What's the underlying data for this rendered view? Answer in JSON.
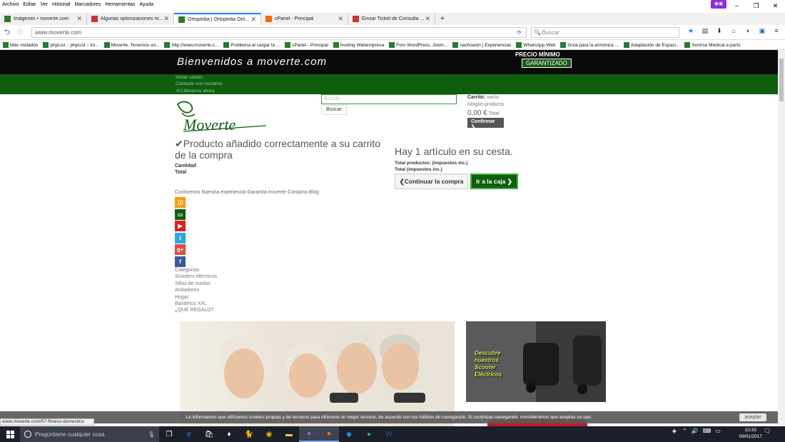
{
  "menubar": [
    "Archivo",
    "Editar",
    "Ver",
    "Historial",
    "Marcadores",
    "Herramientas",
    "Ayuda"
  ],
  "tabs": [
    {
      "title": "Imágenes • moverte.com",
      "fav": "#2a7a2a"
    },
    {
      "title": "Algunas optimizaciones re...",
      "fav": "#c33"
    },
    {
      "title": "Ortopedia | Ortopedia Onl...",
      "fav": "#2a7a2a"
    },
    {
      "title": "cPanel - Principal",
      "fav": "#f60"
    },
    {
      "title": "Enviar Ticket de Consulta ...",
      "fav": "#c33"
    }
  ],
  "url": "www.moverte.com",
  "search_placeholder": "Buscar",
  "bookmarks": [
    "Más visitados",
    "phpList :: phpList :: ini...",
    "Moverte. Tenemos un...",
    "http://www.moverte.c...",
    "Problema al cargar la ...",
    "cPanel - Principal",
    "hosting Webempresa",
    "Foro WordPress, Joom...",
    "nachoasin | Experiencias",
    "WhatsApp Web",
    "Guía para la armónica ...",
    "Adaptación de Espaci...",
    "Sunrise Medical e-parts"
  ],
  "site": {
    "welcome": "Bienvenidos a moverte.com",
    "precio": "PRECIO MÍNIMO",
    "garantizado": "GARANTIZADO",
    "top_links": [
      "Iniciar sesión",
      "Contacte con nosotros",
      "☏Llámanos ahora"
    ],
    "logo": "Moverte",
    "search_placeholder": "Buscar",
    "search_button": "Buscar",
    "cart_label": "Carrito:",
    "cart_state": "vacío",
    "no_product": "Ningún producto",
    "cart_total": "0,00 €",
    "total_word": "Total",
    "confirm": "Confirmar",
    "added_msg": "✔Producto añadido correctamente a su carrito de la compra",
    "cantidad": "Cantidad",
    "total": "Total",
    "hay": "Hay 1 artículo en su cesta.",
    "total_productos": "Total productos: (impuestos inc.)",
    "total_impuestos": "Total (impuestos inc.)",
    "continue": "Continuar la compra",
    "checkout": "Ir a la caja",
    "footer_links": "Conócenos Nuestra experiencia Garantía moverte Contacta Blog",
    "categories": [
      "Categorías",
      "Scooters eléctricos",
      "Sillas de ruedas",
      "Andadores",
      "Hogar",
      "Bariátrico XXL",
      "¿QUÉ REGALO?"
    ],
    "promo_text": "Descubre nuestros Scooter Eléctricos"
  },
  "cookie_text": "Le informamos que utilizamos cookies propias y de terceros para ofrecerte un mejor servicio, de acuerdo con tus hábitos de navegación. Si continúas navegando, consideramos que aceptas su uso.",
  "cookie_accept": "aceptar",
  "status_url": "www.moverte.com/57-fitness-domestico",
  "taskbar": {
    "cortana": "Pregúntame cualquier cosa",
    "time": "10:33",
    "date": "09/01/2017"
  }
}
